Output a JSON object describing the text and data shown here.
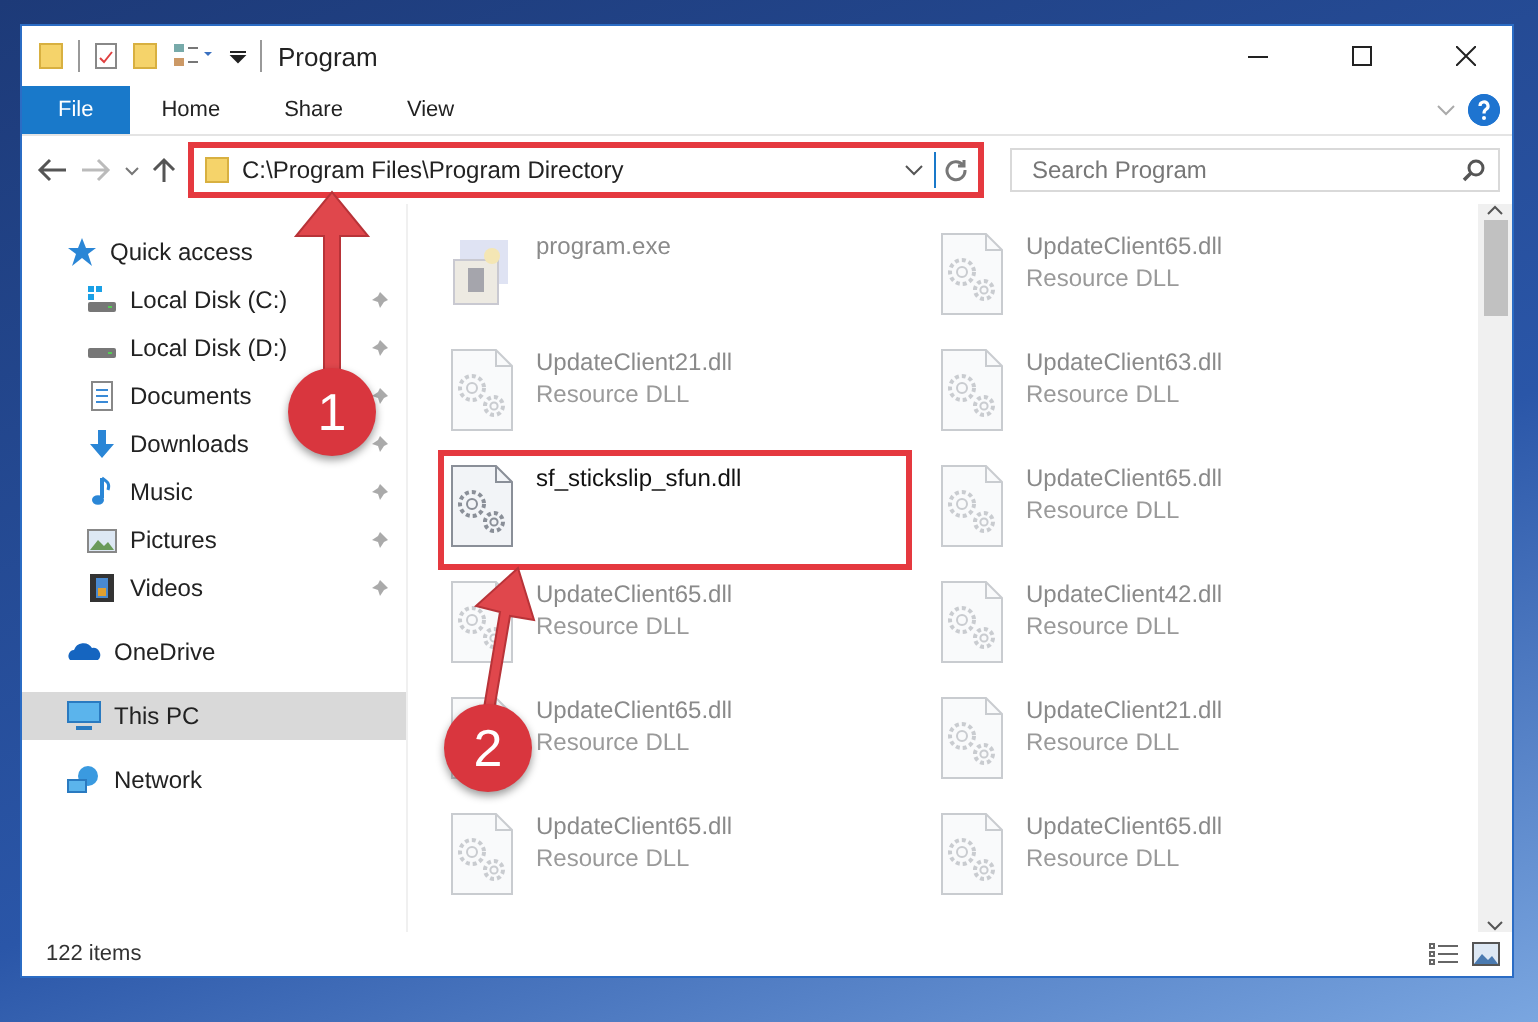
{
  "window": {
    "title": "Program"
  },
  "ribbon_tabs": [
    {
      "label": "File",
      "selected": true
    },
    {
      "label": "Home",
      "selected": false
    },
    {
      "label": "Share",
      "selected": false
    },
    {
      "label": "View",
      "selected": false
    }
  ],
  "address": {
    "value": "C:\\Program Files\\Program Directory",
    "highlighted": true
  },
  "search": {
    "placeholder": "Search Program"
  },
  "sidebar": {
    "items": [
      {
        "label": "Quick access",
        "kind": "star",
        "selected": false,
        "children": [
          {
            "label": "Local Disk (C:)",
            "kind": "system-drive",
            "pinned": true,
            "selected": false
          },
          {
            "label": "Local Disk (D:)",
            "kind": "drive",
            "pinned": true,
            "selected": false
          },
          {
            "label": "Documents",
            "kind": "documents",
            "pinned": true,
            "selected": false
          },
          {
            "label": "Downloads",
            "kind": "downloads",
            "pinned": true,
            "selected": false
          },
          {
            "label": "Music",
            "kind": "music",
            "pinned": true,
            "selected": false
          },
          {
            "label": "Pictures",
            "kind": "pictures",
            "pinned": true,
            "selected": false
          },
          {
            "label": "Videos",
            "kind": "videos",
            "pinned": true,
            "selected": false
          }
        ]
      },
      {
        "label": "OneDrive",
        "kind": "cloud",
        "selected": false
      },
      {
        "label": "This PC",
        "kind": "pc",
        "selected": true
      },
      {
        "label": "Network",
        "kind": "network",
        "selected": false
      }
    ]
  },
  "files": [
    {
      "name": "program.exe",
      "kind": "exe",
      "dimmed": true,
      "highlighted": false
    },
    {
      "name": "UpdateClient65.dll",
      "type": "Resource DLL",
      "kind": "dll",
      "dimmed": true,
      "highlighted": false
    },
    {
      "name": "UpdateClient21.dll",
      "type": "Resource DLL",
      "kind": "dll",
      "dimmed": true,
      "highlighted": false
    },
    {
      "name": "UpdateClient63.dll",
      "type": "Resource DLL",
      "kind": "dll",
      "dimmed": true,
      "highlighted": false
    },
    {
      "name": "sf_stickslip_sfun.dll",
      "kind": "dll",
      "dimmed": false,
      "highlighted": true
    },
    {
      "name": "UpdateClient65.dll",
      "type": "Resource DLL",
      "kind": "dll",
      "dimmed": true,
      "highlighted": false
    },
    {
      "name": "UpdateClient65.dll",
      "type": "Resource DLL",
      "kind": "dll",
      "dimmed": true,
      "highlighted": false
    },
    {
      "name": "UpdateClient42.dll",
      "type": "Resource DLL",
      "kind": "dll",
      "dimmed": true,
      "highlighted": false
    },
    {
      "name": "UpdateClient65.dll",
      "type": "Resource DLL",
      "kind": "dll",
      "dimmed": true,
      "highlighted": false
    },
    {
      "name": "UpdateClient21.dll",
      "type": "Resource DLL",
      "kind": "dll",
      "dimmed": true,
      "highlighted": false
    },
    {
      "name": "UpdateClient65.dll",
      "type": "Resource DLL",
      "kind": "dll",
      "dimmed": true,
      "highlighted": false
    },
    {
      "name": "UpdateClient65.dll",
      "type": "Resource DLL",
      "kind": "dll",
      "dimmed": true,
      "highlighted": false
    }
  ],
  "callouts": [
    {
      "number": "1"
    },
    {
      "number": "2"
    }
  ],
  "status_bar": {
    "item_count": "122 items"
  }
}
